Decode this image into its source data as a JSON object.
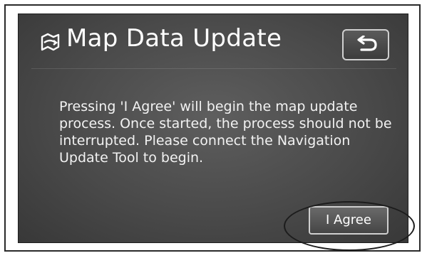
{
  "dialog": {
    "title": "Map Data Update",
    "title_icon": "map-update-icon",
    "back_icon": "return-arrow-icon",
    "message": "Pressing 'I Agree' will begin the map update process. Once started, the process should not be interrupted. Please connect the Navigation Update Tool to begin.",
    "agree_label": "I Agree"
  },
  "colors": {
    "screen_background": "#4a4a4a",
    "text": "#ffffff",
    "button_border": "#cfcfcf"
  }
}
